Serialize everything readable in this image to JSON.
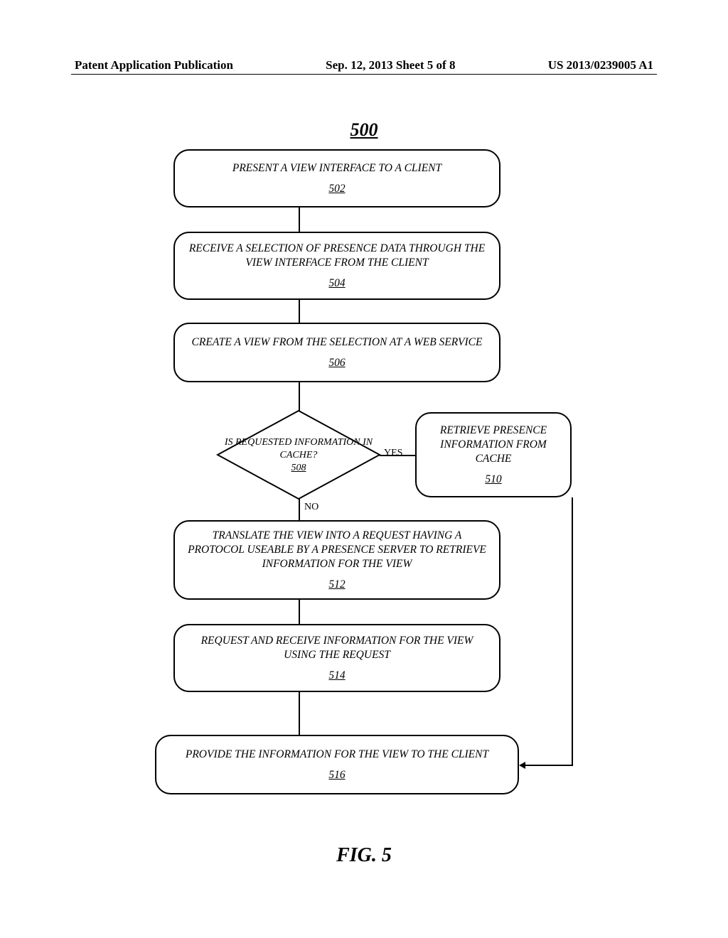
{
  "header": {
    "left": "Patent Application Publication",
    "mid": "Sep. 12, 2013  Sheet 5 of 8",
    "right": "US 2013/0239005 A1"
  },
  "figure_number": "500",
  "caption": "FIG. 5",
  "steps": {
    "s502": {
      "text": "PRESENT A VIEW INTERFACE TO A CLIENT",
      "ref": "502"
    },
    "s504": {
      "text": "RECEIVE A SELECTION OF PRESENCE DATA THROUGH THE VIEW INTERFACE FROM THE CLIENT",
      "ref": "504"
    },
    "s506": {
      "text": "CREATE A VIEW FROM THE SELECTION AT A WEB SERVICE",
      "ref": "506"
    },
    "s508": {
      "text": "IS REQUESTED INFORMATION IN CACHE?",
      "ref": "508"
    },
    "s510": {
      "text": "RETRIEVE PRESENCE INFORMATION FROM CACHE",
      "ref": "510"
    },
    "s512": {
      "text": "TRANSLATE THE VIEW INTO A REQUEST HAVING A PROTOCOL USEABLE BY A PRESENCE SERVER TO RETRIEVE INFORMATION FOR THE VIEW",
      "ref": "512"
    },
    "s514": {
      "text": "REQUEST AND RECEIVE INFORMATION FOR THE VIEW USING THE REQUEST",
      "ref": "514"
    },
    "s516": {
      "text": "PROVIDE THE INFORMATION FOR THE VIEW TO THE CLIENT",
      "ref": "516"
    }
  },
  "labels": {
    "yes": "YES",
    "no": "NO"
  }
}
